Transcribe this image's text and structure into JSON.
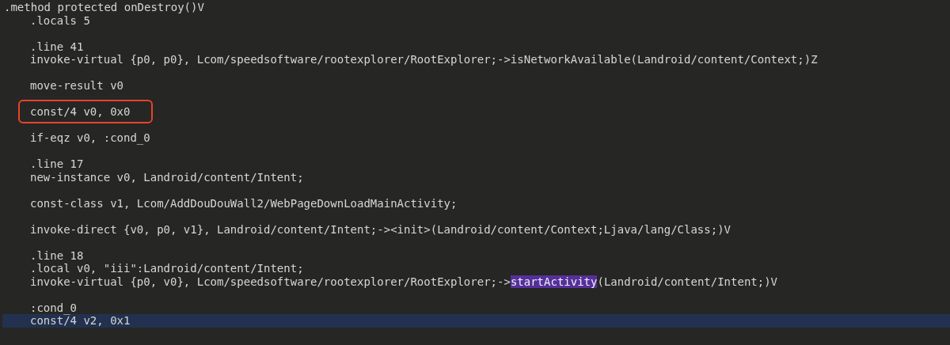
{
  "method": {
    "header": ".method protected onDestroy()V",
    "body": [
      {
        "kind": "code",
        "text": ".locals 5",
        "current": false,
        "boxed": false
      },
      {
        "kind": "blank"
      },
      {
        "kind": "code",
        "text": ".line 41",
        "current": false,
        "boxed": false
      },
      {
        "kind": "code",
        "text": "invoke-virtual {p0, p0}, Lcom/speedsoftware/rootexplorer/RootExplorer;->isNetworkAvailable(Landroid/content/Context;)Z",
        "current": false,
        "boxed": false
      },
      {
        "kind": "blank"
      },
      {
        "kind": "code",
        "text": "move-result v0",
        "current": false,
        "boxed": false
      },
      {
        "kind": "blank"
      },
      {
        "kind": "code",
        "text": "const/4 v0, 0x0",
        "current": false,
        "boxed": true
      },
      {
        "kind": "blank"
      },
      {
        "kind": "code",
        "text": "if-eqz v0, :cond_0",
        "current": false,
        "boxed": false
      },
      {
        "kind": "blank"
      },
      {
        "kind": "code",
        "text": ".line 17",
        "current": false,
        "boxed": false
      },
      {
        "kind": "code",
        "text": "new-instance v0, Landroid/content/Intent;",
        "current": false,
        "boxed": false
      },
      {
        "kind": "blank"
      },
      {
        "kind": "code",
        "text": "const-class v1, Lcom/AddDouDouWall2/WebPageDownLoadMainActivity;",
        "current": false,
        "boxed": false
      },
      {
        "kind": "blank"
      },
      {
        "kind": "code",
        "text": "invoke-direct {v0, p0, v1}, Landroid/content/Intent;-><init>(Landroid/content/Context;Ljava/lang/Class;)V",
        "current": false,
        "boxed": false
      },
      {
        "kind": "blank"
      },
      {
        "kind": "code",
        "text": ".line 18",
        "current": false,
        "boxed": false
      },
      {
        "kind": "code",
        "text": ".local v0, \"iii\":Landroid/content/Intent;",
        "current": false,
        "boxed": false
      },
      {
        "kind": "parts",
        "parts": [
          {
            "text": "invoke-virtual {p0, v0}, Lcom/speedsoftware/rootexplorer/RootExplorer;->",
            "selected": false
          },
          {
            "text": "startActivity",
            "selected": true
          },
          {
            "text": "(Landroid/content/Intent;)V",
            "selected": false
          }
        ]
      },
      {
        "kind": "blank"
      },
      {
        "kind": "code",
        "text": ":cond_0",
        "current": false,
        "boxed": false
      },
      {
        "kind": "code",
        "text": "const/4 v2, 0x1",
        "current": true,
        "boxed": false
      }
    ]
  }
}
